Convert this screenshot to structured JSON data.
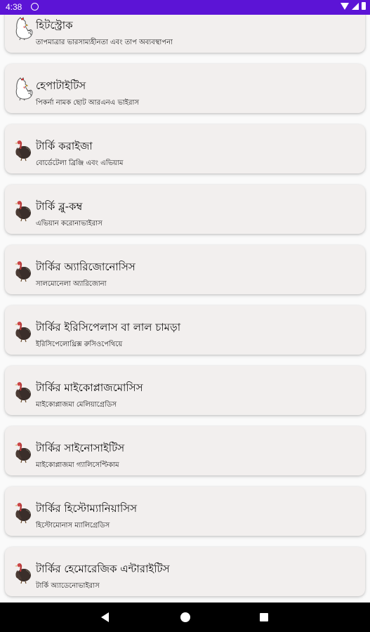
{
  "status_bar": {
    "time": "4:38"
  },
  "items": [
    {
      "title": "হিটস্ট্রোক",
      "subtitle": "তাপমাত্রার ভারসাম্যহীনতা এবং তাপ অব্যবস্থাপনা",
      "icon": "rooster-icon"
    },
    {
      "title": "হেপাটাইটিস",
      "subtitle": "পিকর্না নামক ছোট আরএনএ ভাইরাস",
      "icon": "rooster-icon"
    },
    {
      "title": "টার্কি করাইজা",
      "subtitle": "বোর্ডেটেলা ব্রিঞ্জি এবং এভিয়াম",
      "icon": "turkey-icon"
    },
    {
      "title": "টার্কি ব্লু-কম্ব",
      "subtitle": "এভিয়ান করোনাভাইরাস",
      "icon": "turkey-icon"
    },
    {
      "title": "টার্কির অ্যারিজোনোসিস",
      "subtitle": "সালমোনেলা অ্যারিজোনা",
      "icon": "turkey-icon"
    },
    {
      "title": "টার্কির ইরিসিপেলাস বা লাল চামড়া",
      "subtitle": "ইরিসিপেলোথ্রিক্স রুসিওপেথিয়ে",
      "icon": "turkey-icon"
    },
    {
      "title": "টার্কির মাইকোপ্লাজমোসিস",
      "subtitle": "মাইকোপ্লাজমা মেলিয়াগ্রেডিস",
      "icon": "turkey-icon"
    },
    {
      "title": "টার্কির সাইনোসাইটিস",
      "subtitle": "মাইকোপ্লাজমা গ্যালিসেপ্টিকাম",
      "icon": "turkey-icon"
    },
    {
      "title": "টার্কির হিস্টোম্যানিয়াসিস",
      "subtitle": "হিস্টোমোনাস ম্যালিগ্রেডিস",
      "icon": "turkey-icon"
    },
    {
      "title": "টার্কির হেমোরেজিক এন্টারাইটিস",
      "subtitle": "টার্কি অ্যাডেনোভাইরাস",
      "icon": "turkey-icon"
    }
  ]
}
